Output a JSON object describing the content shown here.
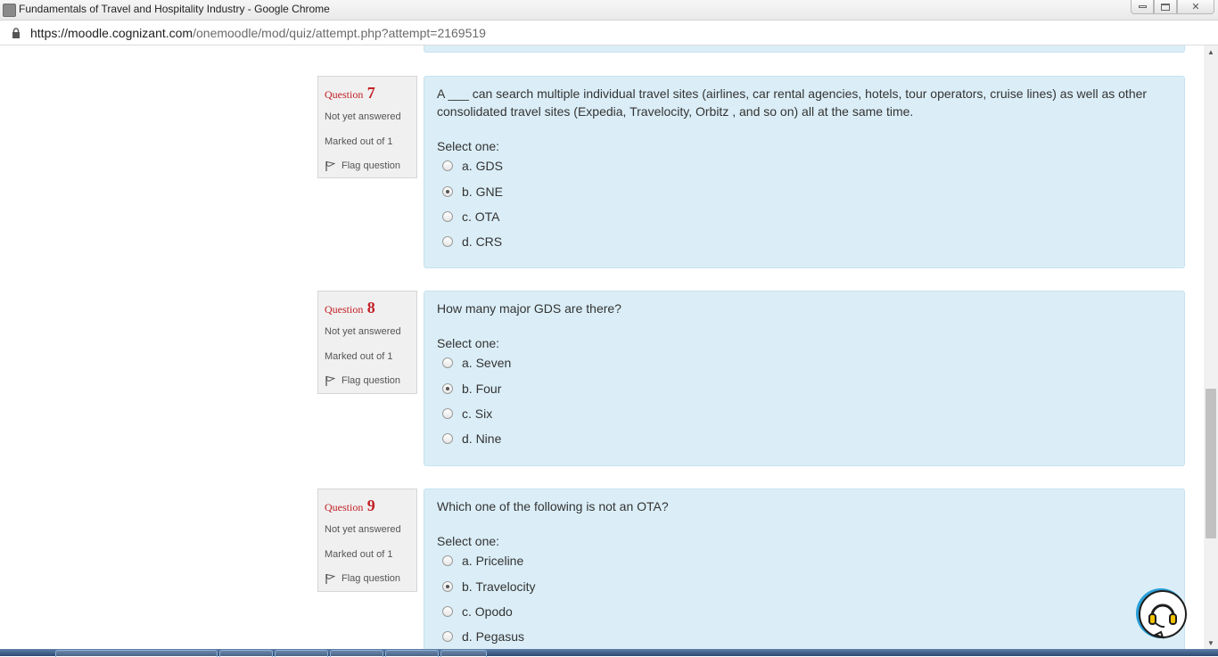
{
  "window": {
    "title": "Fundamentals of Travel and Hospitality Industry - Google Chrome"
  },
  "address_bar": {
    "url_host": "https://moodle.cognizant.com",
    "url_path": "/onemoodle/mod/quiz/attempt.php?attempt=2169519"
  },
  "questions": [
    {
      "label": "Question",
      "number": "7",
      "status": "Not yet answered",
      "marks": "Marked out of 1",
      "flag_label": "Flag question",
      "text": "A ___ can search multiple individual travel sites (airlines, car rental agencies, hotels, tour operators, cruise lines) as well as other consolidated travel sites (Expedia, Travelocity, Orbitz , and so on) all at the same time.",
      "prompt": "Select one:",
      "options": [
        "a. GDS",
        "b. GNE",
        "c. OTA",
        "d. CRS"
      ],
      "selected_index": 1
    },
    {
      "label": "Question",
      "number": "8",
      "status": "Not yet answered",
      "marks": "Marked out of 1",
      "flag_label": "Flag question",
      "text": "How many major GDS are there?",
      "prompt": "Select one:",
      "options": [
        "a. Seven",
        "b. Four",
        "c. Six",
        "d. Nine"
      ],
      "selected_index": 1
    },
    {
      "label": "Question",
      "number": "9",
      "status": "Not yet answered",
      "marks": "Marked out of 1",
      "flag_label": "Flag question",
      "text": "Which one of the following is not an OTA?",
      "prompt": "Select one:",
      "options": [
        "a. Priceline",
        "b. Travelocity",
        "c. Opodo",
        "d. Pegasus"
      ],
      "selected_index": 1
    }
  ],
  "colors": {
    "question_number": "#c22026",
    "content_background": "#dbeef7",
    "info_background": "#f0f0f0"
  },
  "icons": {
    "flag": "flag-icon",
    "lock": "lock-icon",
    "chat": "headset-chat-icon"
  }
}
